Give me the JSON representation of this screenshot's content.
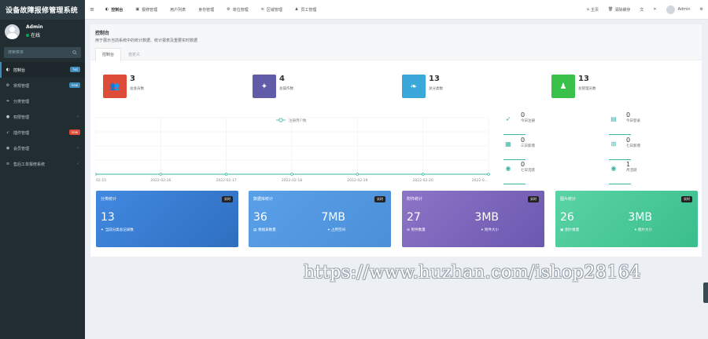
{
  "app": {
    "title": "设备故障报修管理系统"
  },
  "user": {
    "name": "Admin",
    "status": "在线"
  },
  "search": {
    "placeholder": "搜索菜单"
  },
  "sidebar": {
    "items": [
      {
        "label": "控制台",
        "icon": "dashboard-icon",
        "badge": "hot",
        "active": true
      },
      {
        "label": "常规管理",
        "icon": "cogs-icon",
        "badge": "new"
      },
      {
        "label": "分类管理",
        "icon": "leaf-icon"
      },
      {
        "label": "权限管理",
        "icon": "group-icon",
        "chevron": "‹"
      },
      {
        "label": "插件管理",
        "icon": "rocket-icon",
        "badge": "new"
      },
      {
        "label": "会员管理",
        "icon": "user-circle-icon",
        "chevron": "‹"
      },
      {
        "label": "售后工单报修系统",
        "icon": "list-icon",
        "chevron": "‹"
      }
    ]
  },
  "topnav": {
    "tabs": [
      {
        "label": "控制台",
        "icon": "dashboard-icon",
        "active": true
      },
      {
        "label": "报修管理",
        "icon": "camera-icon"
      },
      {
        "label": "用户列表"
      },
      {
        "label": "身份管理"
      },
      {
        "label": "单位管理",
        "icon": "cog-icon"
      },
      {
        "label": "区域管理",
        "icon": "list-icon"
      },
      {
        "label": "员工管理",
        "icon": "user-icon"
      }
    ],
    "right": {
      "home": "主页",
      "clear_cache": "清除缓存",
      "admin": "Admin"
    }
  },
  "panel": {
    "title": "控制台",
    "subtitle": "用于展示当前系统中的统计数据、统计报表及重要实时数据",
    "tabs": [
      {
        "label": "控制台",
        "active": true
      },
      {
        "label": "自定义"
      }
    ]
  },
  "stats": [
    {
      "value": "3",
      "label": "总会员数",
      "color": "#dd4b39",
      "icon": "users-icon"
    },
    {
      "value": "4",
      "label": "总操作数",
      "color": "#605ca8",
      "icon": "magic-icon"
    },
    {
      "value": "13",
      "label": "总分类数",
      "color": "#3aa9d9",
      "icon": "leaf-icon"
    },
    {
      "value": "13",
      "label": "总管理员数",
      "color": "#3ac14a",
      "icon": "user-icon"
    }
  ],
  "chart_data": {
    "type": "line",
    "legend": "注册用户数",
    "x_labels": [
      "02-15",
      "2022-02-16",
      "2022-02-17",
      "2022-02-18",
      "2022-02-19",
      "2022-02-20",
      "2022-0..."
    ],
    "values": [
      0,
      0,
      0,
      0,
      0,
      0,
      0
    ],
    "color": "#3bb4a0"
  },
  "right_stats": [
    {
      "value": "0",
      "label": "今日注册",
      "icon": "rocket-icon"
    },
    {
      "value": "0",
      "label": "今日登录",
      "icon": "vcard-icon"
    },
    {
      "value": "0",
      "label": "三日新增",
      "icon": "calendar-icon"
    },
    {
      "value": "0",
      "label": "七日新增",
      "icon": "calendar-plus-icon"
    },
    {
      "value": "0",
      "label": "七日活跃",
      "icon": "user-circle-icon"
    },
    {
      "value": "1",
      "label": "月活跃",
      "icon": "user-circle-icon"
    }
  ],
  "cards": [
    {
      "title": "分类统计",
      "tag": "实时",
      "big1": "13",
      "big2": "",
      "foot1": "当前分类总记录数",
      "foot2": "",
      "gradient": [
        "#4189e0",
        "#2f6fc0"
      ]
    },
    {
      "title": "数据库统计",
      "tag": "实时",
      "big1": "36",
      "big2": "7MB",
      "foot1": "数据表数量",
      "foot2": "占用空间",
      "gradient": [
        "#5aa0e8",
        "#4a8fd8"
      ]
    },
    {
      "title": "附件统计",
      "tag": "实时",
      "big1": "27",
      "big2": "3MB",
      "foot1": "附件数量",
      "foot2": "附件大小",
      "gradient": [
        "#8d74c6",
        "#6b58b0"
      ]
    },
    {
      "title": "图片统计",
      "tag": "实时",
      "big1": "26",
      "big2": "3MB",
      "foot1": "图片数量",
      "foot2": "图片大小",
      "gradient": [
        "#59d4a5",
        "#3bbd8c"
      ]
    }
  ],
  "watermark": "https://www.huzhan.com/ishop28164"
}
